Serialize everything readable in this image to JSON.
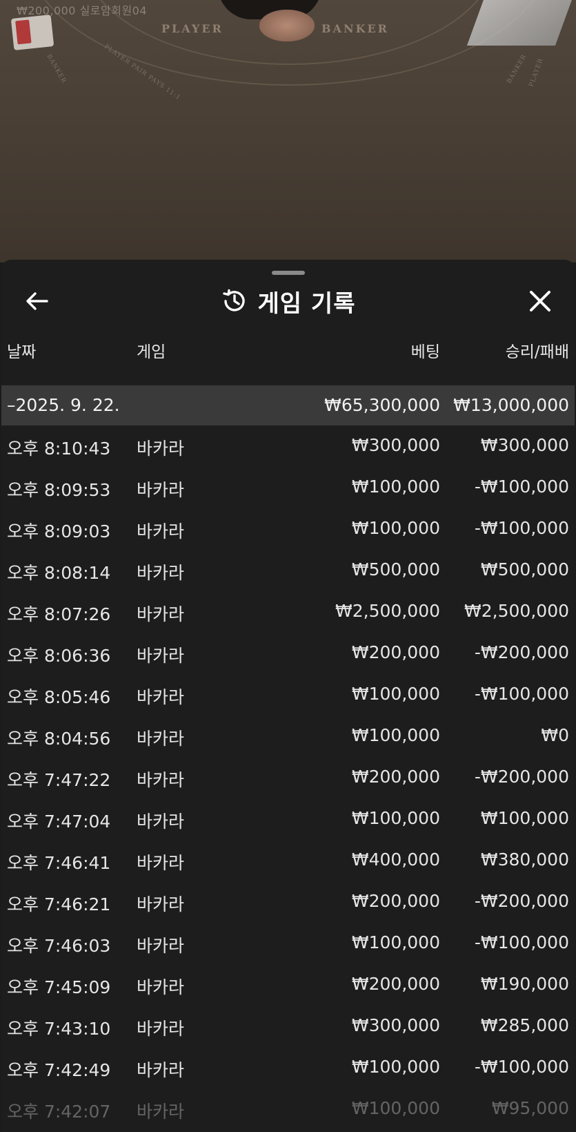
{
  "background": {
    "top_text": "₩200,000  실로암회원04",
    "table_left_label": "PLAYER",
    "table_right_label": "BANKER",
    "side_label_left": "BANKER",
    "side_label_left2": "PLAYER PAIR PAYS 11:1",
    "side_label_right": "BANKER",
    "side_label_right2": "PLAYER"
  },
  "sheet": {
    "title": "게임 기록",
    "icons": {
      "back": "arrow-left-icon",
      "history": "history-clock-icon",
      "close": "close-icon"
    }
  },
  "columns": {
    "date": "날짜",
    "game": "게임",
    "bet": "베팅",
    "win_loss": "승리/패배"
  },
  "date_group": {
    "label": "–2025. 9. 22.",
    "bet_total": "₩65,300,000",
    "win_total": "₩13,000,000"
  },
  "rows": [
    {
      "time": "오후 8:10:43",
      "game": "바카라",
      "bet": "₩300,000",
      "result": "₩300,000"
    },
    {
      "time": "오후 8:09:53",
      "game": "바카라",
      "bet": "₩100,000",
      "result": "-₩100,000"
    },
    {
      "time": "오후 8:09:03",
      "game": "바카라",
      "bet": "₩100,000",
      "result": "-₩100,000"
    },
    {
      "time": "오후 8:08:14",
      "game": "바카라",
      "bet": "₩500,000",
      "result": "₩500,000"
    },
    {
      "time": "오후 8:07:26",
      "game": "바카라",
      "bet": "₩2,500,000",
      "result": "₩2,500,000"
    },
    {
      "time": "오후 8:06:36",
      "game": "바카라",
      "bet": "₩200,000",
      "result": "-₩200,000"
    },
    {
      "time": "오후 8:05:46",
      "game": "바카라",
      "bet": "₩100,000",
      "result": "-₩100,000"
    },
    {
      "time": "오후 8:04:56",
      "game": "바카라",
      "bet": "₩100,000",
      "result": "₩0"
    },
    {
      "time": "오후 7:47:22",
      "game": "바카라",
      "bet": "₩200,000",
      "result": "-₩200,000"
    },
    {
      "time": "오후 7:47:04",
      "game": "바카라",
      "bet": "₩100,000",
      "result": "₩100,000"
    },
    {
      "time": "오후 7:46:41",
      "game": "바카라",
      "bet": "₩400,000",
      "result": "₩380,000"
    },
    {
      "time": "오후 7:46:21",
      "game": "바카라",
      "bet": "₩200,000",
      "result": "-₩200,000"
    },
    {
      "time": "오후 7:46:03",
      "game": "바카라",
      "bet": "₩100,000",
      "result": "-₩100,000"
    },
    {
      "time": "오후 7:45:09",
      "game": "바카라",
      "bet": "₩200,000",
      "result": "₩190,000"
    },
    {
      "time": "오후 7:43:10",
      "game": "바카라",
      "bet": "₩300,000",
      "result": "₩285,000"
    },
    {
      "time": "오후 7:42:49",
      "game": "바카라",
      "bet": "₩100,000",
      "result": "-₩100,000"
    },
    {
      "time": "오후 7:42:07",
      "game": "바카라",
      "bet": "₩100,000",
      "result": "₩95,000"
    }
  ]
}
